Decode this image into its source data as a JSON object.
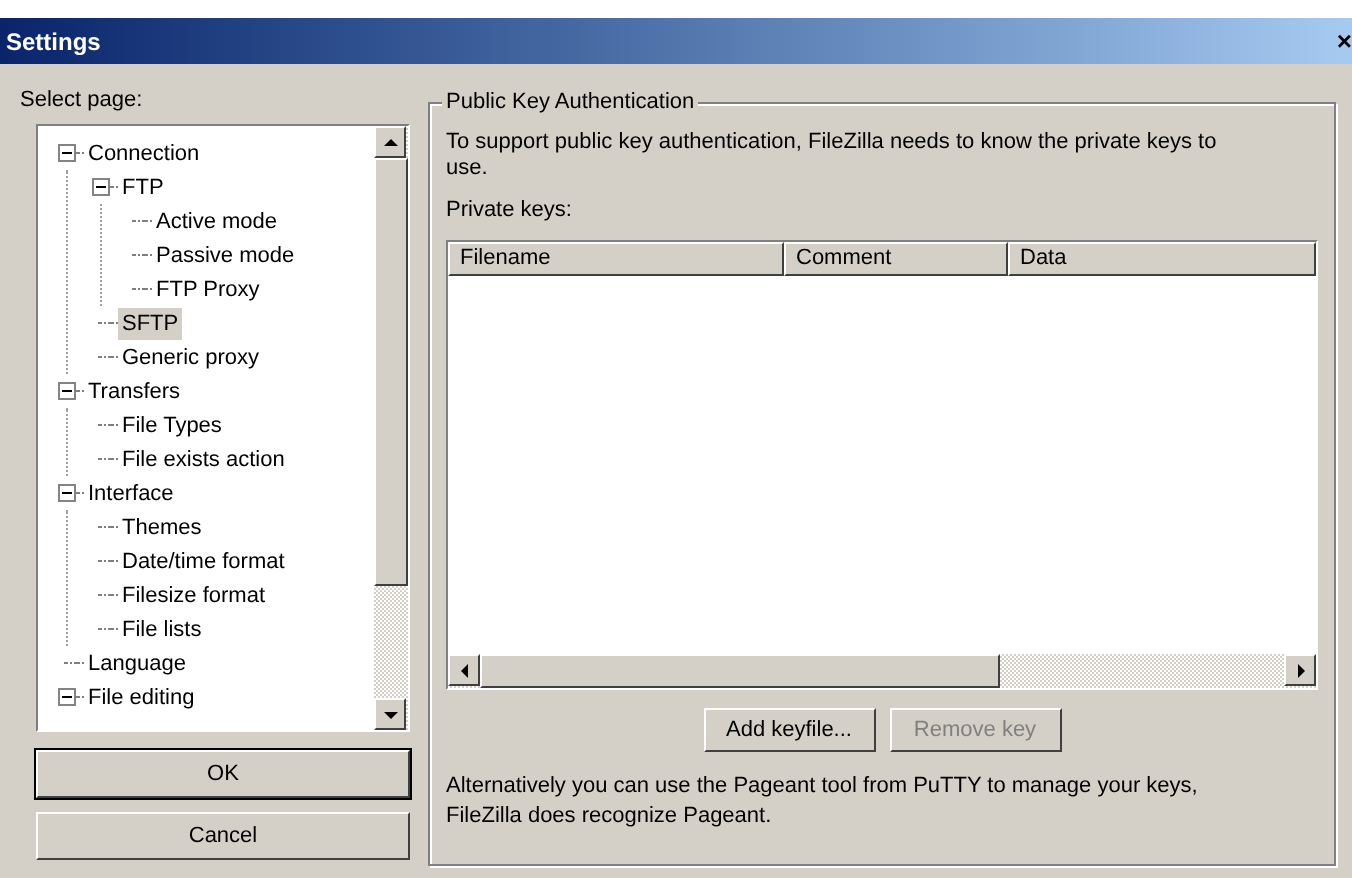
{
  "window": {
    "title": "Settings",
    "close": "×"
  },
  "sidebar": {
    "label": "Select page:",
    "tree": [
      {
        "label": "Connection",
        "expanded": true,
        "selected": false,
        "children": [
          {
            "label": "FTP",
            "expanded": true,
            "selected": false,
            "children": [
              {
                "label": "Active mode",
                "selected": false
              },
              {
                "label": "Passive mode",
                "selected": false
              },
              {
                "label": "FTP Proxy",
                "selected": false
              }
            ]
          },
          {
            "label": "SFTP",
            "selected": true
          },
          {
            "label": "Generic proxy",
            "selected": false
          }
        ]
      },
      {
        "label": "Transfers",
        "expanded": true,
        "selected": false,
        "children": [
          {
            "label": "File Types",
            "selected": false
          },
          {
            "label": "File exists action",
            "selected": false
          }
        ]
      },
      {
        "label": "Interface",
        "expanded": true,
        "selected": false,
        "children": [
          {
            "label": "Themes",
            "selected": false
          },
          {
            "label": "Date/time format",
            "selected": false
          },
          {
            "label": "Filesize format",
            "selected": false
          },
          {
            "label": "File lists",
            "selected": false
          }
        ]
      },
      {
        "label": "Language",
        "selected": false
      },
      {
        "label": "File editing",
        "expanded": true,
        "selected": false
      }
    ]
  },
  "buttons": [
    {
      "label": "OK",
      "default": true
    },
    {
      "label": "Cancel",
      "default": false
    }
  ],
  "group": {
    "title": "Public Key Authentication",
    "intro": "To support public key authentication, FileZilla needs to know the private keys to use.",
    "list_label": "Private keys:",
    "table": {
      "columns": [
        "Filename",
        "Comment",
        "Data"
      ]
    },
    "actions": [
      {
        "label": "Add keyfile...",
        "disabled": false
      },
      {
        "label": "Remove key",
        "disabled": true
      }
    ],
    "note": "Alternatively you can use the Pageant tool from PuTTY to manage your keys, FileZilla does recognize Pageant."
  }
}
